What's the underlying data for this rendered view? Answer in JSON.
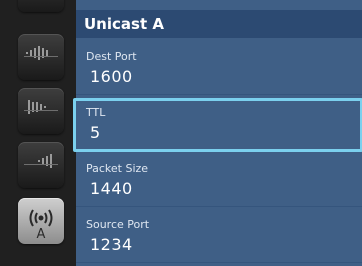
{
  "panel": {
    "title": "Unicast A",
    "fields": [
      {
        "label": "Dest Port",
        "value": "1600",
        "selected": false
      },
      {
        "label": "TTL",
        "value": "5",
        "selected": true
      },
      {
        "label": "Packet Size",
        "value": "1440",
        "selected": false
      },
      {
        "label": "Source Port",
        "value": "1234",
        "selected": false
      }
    ]
  },
  "sidebar": {
    "buttons": [
      {
        "icon": "signal-bars-icon",
        "active": false
      },
      {
        "icon": "signal-bars-mid-icon",
        "active": false
      },
      {
        "icon": "signal-bars-high-icon",
        "active": false
      },
      {
        "icon": "wireless-antenna-icon",
        "active": true,
        "glyph": "A"
      }
    ]
  },
  "colors": {
    "panel_bg": "#3f5f86",
    "header_bg": "#2c4a72",
    "focus_ring": "#7bd0ee",
    "sidebar_bg": "#202020"
  }
}
